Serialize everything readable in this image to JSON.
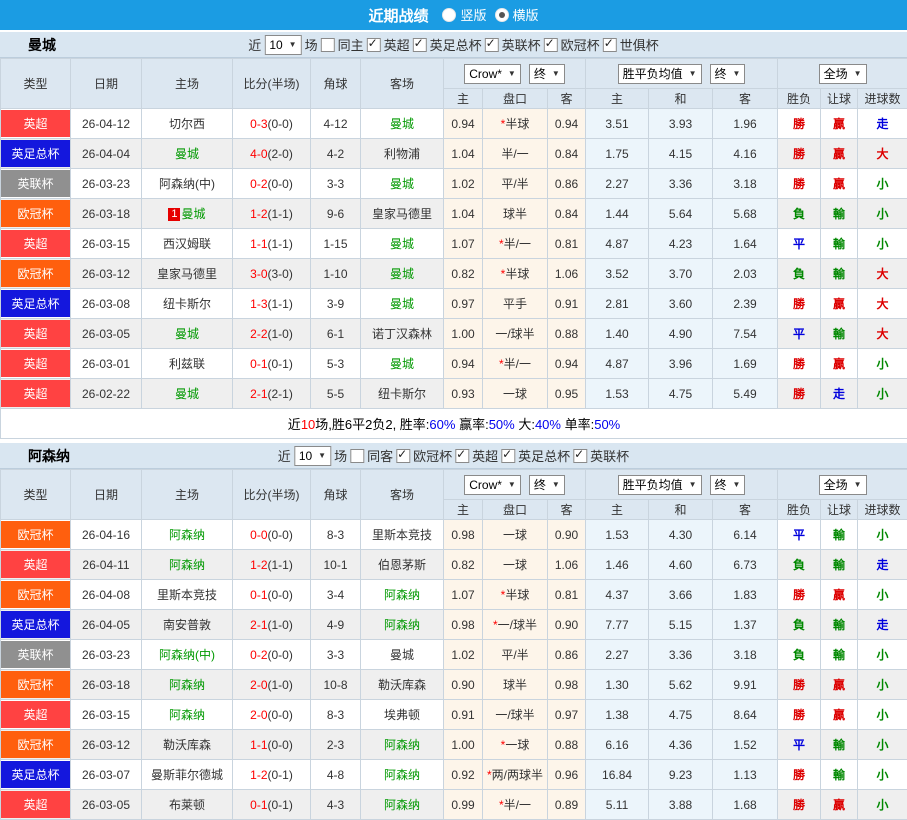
{
  "topbar": {
    "title": "近期战绩",
    "radios": [
      {
        "label": "竖版",
        "checked": false
      },
      {
        "label": "横版",
        "checked": true
      }
    ]
  },
  "table_head": {
    "type": "类型",
    "date": "日期",
    "home": "主场",
    "score": "比分(半场)",
    "corner": "角球",
    "away": "客场",
    "h": "主",
    "handicap": "盘口",
    "a": "客",
    "avg_h": "主",
    "avg_d": "和",
    "avg_a": "客",
    "result": "胜负",
    "let_ball": "让球",
    "goals": "进球数"
  },
  "selects": {
    "near_count": "10",
    "odds": "Crow*",
    "final": "终",
    "avg": "胜平负均值",
    "final2": "终",
    "scope": "全场"
  },
  "labels": {
    "near": "近",
    "matches": "场"
  },
  "league_colors": {
    "英超": "#ff4242",
    "英足总杯": "#1417dd",
    "英联杯": "#909090",
    "欧冠杯": "#ff5f0e"
  },
  "sections": [
    {
      "team": "曼城",
      "same_label": "同主",
      "same_checked": false,
      "filters": [
        "英超",
        "英足总杯",
        "英联杯",
        "欧冠杯",
        "世俱杯"
      ],
      "rows": [
        {
          "lg": "英超",
          "date": "26-04-12",
          "home": "切尔西",
          "hHL": false,
          "rank": "",
          "score": "0-3",
          "ht": "(0-0)",
          "cor": "4-12",
          "away": "曼城",
          "aHL": true,
          "o1": "0.94",
          "hc": "*半球",
          "o2": "0.94",
          "m1": "3.51",
          "m2": "3.93",
          "m3": "1.96",
          "res": [
            "勝",
            "r"
          ],
          "let": [
            "贏",
            "r"
          ],
          "goal": [
            "走",
            "b"
          ]
        },
        {
          "lg": "英足总杯",
          "date": "26-04-04",
          "home": "曼城",
          "hHL": true,
          "rank": "",
          "score": "4-0",
          "ht": "(2-0)",
          "cor": "4-2",
          "away": "利物浦",
          "aHL": false,
          "o1": "1.04",
          "hc": "半/一",
          "o2": "0.84",
          "m1": "1.75",
          "m2": "4.15",
          "m3": "4.16",
          "res": [
            "勝",
            "r"
          ],
          "let": [
            "贏",
            "r"
          ],
          "goal": [
            "大",
            "r"
          ]
        },
        {
          "lg": "英联杯",
          "date": "26-03-23",
          "home": "阿森纳(中)",
          "hHL": false,
          "rank": "",
          "score": "0-2",
          "ht": "(0-0)",
          "cor": "3-3",
          "away": "曼城",
          "aHL": true,
          "o1": "1.02",
          "hc": "平/半",
          "o2": "0.86",
          "m1": "2.27",
          "m2": "3.36",
          "m3": "3.18",
          "res": [
            "勝",
            "r"
          ],
          "let": [
            "贏",
            "r"
          ],
          "goal": [
            "小",
            "g"
          ]
        },
        {
          "lg": "欧冠杯",
          "date": "26-03-18",
          "home": "曼城",
          "hHL": true,
          "rank": "1",
          "score": "1-2",
          "ht": "(1-1)",
          "cor": "9-6",
          "away": "皇家马德里",
          "aHL": false,
          "o1": "1.04",
          "hc": "球半",
          "o2": "0.84",
          "m1": "1.44",
          "m2": "5.64",
          "m3": "5.68",
          "res": [
            "負",
            "g"
          ],
          "let": [
            "輸",
            "g"
          ],
          "goal": [
            "小",
            "g"
          ]
        },
        {
          "lg": "英超",
          "date": "26-03-15",
          "home": "西汉姆联",
          "hHL": false,
          "rank": "",
          "score": "1-1",
          "ht": "(1-1)",
          "cor": "1-15",
          "away": "曼城",
          "aHL": true,
          "o1": "1.07",
          "hc": "*半/一",
          "o2": "0.81",
          "m1": "4.87",
          "m2": "4.23",
          "m3": "1.64",
          "res": [
            "平",
            "b"
          ],
          "let": [
            "輸",
            "g"
          ],
          "goal": [
            "小",
            "g"
          ]
        },
        {
          "lg": "欧冠杯",
          "date": "26-03-12",
          "home": "皇家马德里",
          "hHL": false,
          "rank": "",
          "score": "3-0",
          "ht": "(3-0)",
          "cor": "1-10",
          "away": "曼城",
          "aHL": true,
          "o1": "0.82",
          "hc": "*半球",
          "o2": "1.06",
          "m1": "3.52",
          "m2": "3.70",
          "m3": "2.03",
          "res": [
            "負",
            "g"
          ],
          "let": [
            "輸",
            "g"
          ],
          "goal": [
            "大",
            "r"
          ]
        },
        {
          "lg": "英足总杯",
          "date": "26-03-08",
          "home": "纽卡斯尔",
          "hHL": false,
          "rank": "",
          "score": "1-3",
          "ht": "(1-1)",
          "cor": "3-9",
          "away": "曼城",
          "aHL": true,
          "o1": "0.97",
          "hc": "平手",
          "o2": "0.91",
          "m1": "2.81",
          "m2": "3.60",
          "m3": "2.39",
          "res": [
            "勝",
            "r"
          ],
          "let": [
            "贏",
            "r"
          ],
          "goal": [
            "大",
            "r"
          ]
        },
        {
          "lg": "英超",
          "date": "26-03-05",
          "home": "曼城",
          "hHL": true,
          "rank": "",
          "score": "2-2",
          "ht": "(1-0)",
          "cor": "6-1",
          "away": "诺丁汉森林",
          "aHL": false,
          "o1": "1.00",
          "hc": "一/球半",
          "o2": "0.88",
          "m1": "1.40",
          "m2": "4.90",
          "m3": "7.54",
          "res": [
            "平",
            "b"
          ],
          "let": [
            "輸",
            "g"
          ],
          "goal": [
            "大",
            "r"
          ]
        },
        {
          "lg": "英超",
          "date": "26-03-01",
          "home": "利兹联",
          "hHL": false,
          "rank": "",
          "score": "0-1",
          "ht": "(0-1)",
          "cor": "5-3",
          "away": "曼城",
          "aHL": true,
          "o1": "0.94",
          "hc": "*半/一",
          "o2": "0.94",
          "m1": "4.87",
          "m2": "3.96",
          "m3": "1.69",
          "res": [
            "勝",
            "r"
          ],
          "let": [
            "贏",
            "r"
          ],
          "goal": [
            "小",
            "g"
          ]
        },
        {
          "lg": "英超",
          "date": "26-02-22",
          "home": "曼城",
          "hHL": true,
          "rank": "",
          "score": "2-1",
          "ht": "(2-1)",
          "cor": "5-5",
          "away": "纽卡斯尔",
          "aHL": false,
          "o1": "0.93",
          "hc": "一球",
          "o2": "0.95",
          "m1": "1.53",
          "m2": "4.75",
          "m3": "5.49",
          "res": [
            "勝",
            "r"
          ],
          "let": [
            "走",
            "b"
          ],
          "goal": [
            "小",
            "g"
          ]
        }
      ],
      "summary_parts": [
        [
          "近",
          "k"
        ],
        [
          "10",
          "r"
        ],
        [
          "场,胜6平2负2, 胜率:",
          "k"
        ],
        [
          "60%",
          "b"
        ],
        [
          " 赢率:",
          "k"
        ],
        [
          "50%",
          "b"
        ],
        [
          " 大:",
          "k"
        ],
        [
          "40%",
          "b"
        ],
        [
          " 单率:",
          "k"
        ],
        [
          "50%",
          "b"
        ]
      ]
    },
    {
      "team": "阿森纳",
      "same_label": "同客",
      "same_checked": false,
      "filters": [
        "欧冠杯",
        "英超",
        "英足总杯",
        "英联杯"
      ],
      "rows": [
        {
          "lg": "欧冠杯",
          "date": "26-04-16",
          "home": "阿森纳",
          "hHL": true,
          "rank": "",
          "score": "0-0",
          "ht": "(0-0)",
          "cor": "8-3",
          "away": "里斯本竞技",
          "aHL": false,
          "o1": "0.98",
          "hc": "一球",
          "o2": "0.90",
          "m1": "1.53",
          "m2": "4.30",
          "m3": "6.14",
          "res": [
            "平",
            "b"
          ],
          "let": [
            "輸",
            "g"
          ],
          "goal": [
            "小",
            "g"
          ]
        },
        {
          "lg": "英超",
          "date": "26-04-11",
          "home": "阿森纳",
          "hHL": true,
          "rank": "",
          "score": "1-2",
          "ht": "(1-1)",
          "cor": "10-1",
          "away": "伯恩茅斯",
          "aHL": false,
          "o1": "0.82",
          "hc": "一球",
          "o2": "1.06",
          "m1": "1.46",
          "m2": "4.60",
          "m3": "6.73",
          "res": [
            "負",
            "g"
          ],
          "let": [
            "輸",
            "g"
          ],
          "goal": [
            "走",
            "b"
          ]
        },
        {
          "lg": "欧冠杯",
          "date": "26-04-08",
          "home": "里斯本竞技",
          "hHL": false,
          "rank": "",
          "score": "0-1",
          "ht": "(0-0)",
          "cor": "3-4",
          "away": "阿森纳",
          "aHL": true,
          "o1": "1.07",
          "hc": "*半球",
          "o2": "0.81",
          "m1": "4.37",
          "m2": "3.66",
          "m3": "1.83",
          "res": [
            "勝",
            "r"
          ],
          "let": [
            "贏",
            "r"
          ],
          "goal": [
            "小",
            "g"
          ]
        },
        {
          "lg": "英足总杯",
          "date": "26-04-05",
          "home": "南安普敦",
          "hHL": false,
          "rank": "",
          "score": "2-1",
          "ht": "(1-0)",
          "cor": "4-9",
          "away": "阿森纳",
          "aHL": true,
          "o1": "0.98",
          "hc": "*一/球半",
          "o2": "0.90",
          "m1": "7.77",
          "m2": "5.15",
          "m3": "1.37",
          "res": [
            "負",
            "g"
          ],
          "let": [
            "輸",
            "g"
          ],
          "goal": [
            "走",
            "b"
          ]
        },
        {
          "lg": "英联杯",
          "date": "26-03-23",
          "home": "阿森纳(中)",
          "hHL": true,
          "rank": "",
          "score": "0-2",
          "ht": "(0-0)",
          "cor": "3-3",
          "away": "曼城",
          "aHL": false,
          "o1": "1.02",
          "hc": "平/半",
          "o2": "0.86",
          "m1": "2.27",
          "m2": "3.36",
          "m3": "3.18",
          "res": [
            "負",
            "g"
          ],
          "let": [
            "輸",
            "g"
          ],
          "goal": [
            "小",
            "g"
          ]
        },
        {
          "lg": "欧冠杯",
          "date": "26-03-18",
          "home": "阿森纳",
          "hHL": true,
          "rank": "",
          "score": "2-0",
          "ht": "(1-0)",
          "cor": "10-8",
          "away": "勒沃库森",
          "aHL": false,
          "o1": "0.90",
          "hc": "球半",
          "o2": "0.98",
          "m1": "1.30",
          "m2": "5.62",
          "m3": "9.91",
          "res": [
            "勝",
            "r"
          ],
          "let": [
            "贏",
            "r"
          ],
          "goal": [
            "小",
            "g"
          ]
        },
        {
          "lg": "英超",
          "date": "26-03-15",
          "home": "阿森纳",
          "hHL": true,
          "rank": "",
          "score": "2-0",
          "ht": "(0-0)",
          "cor": "8-3",
          "away": "埃弗顿",
          "aHL": false,
          "o1": "0.91",
          "hc": "一/球半",
          "o2": "0.97",
          "m1": "1.38",
          "m2": "4.75",
          "m3": "8.64",
          "res": [
            "勝",
            "r"
          ],
          "let": [
            "贏",
            "r"
          ],
          "goal": [
            "小",
            "g"
          ]
        },
        {
          "lg": "欧冠杯",
          "date": "26-03-12",
          "home": "勒沃库森",
          "hHL": false,
          "rank": "",
          "score": "1-1",
          "ht": "(0-0)",
          "cor": "2-3",
          "away": "阿森纳",
          "aHL": true,
          "o1": "1.00",
          "hc": "*一球",
          "o2": "0.88",
          "m1": "6.16",
          "m2": "4.36",
          "m3": "1.52",
          "res": [
            "平",
            "b"
          ],
          "let": [
            "輸",
            "g"
          ],
          "goal": [
            "小",
            "g"
          ]
        },
        {
          "lg": "英足总杯",
          "date": "26-03-07",
          "home": "曼斯菲尔德城",
          "hHL": false,
          "rank": "",
          "score": "1-2",
          "ht": "(0-1)",
          "cor": "4-8",
          "away": "阿森纳",
          "aHL": true,
          "o1": "0.92",
          "hc": "*两/两球半",
          "o2": "0.96",
          "m1": "16.84",
          "m2": "9.23",
          "m3": "1.13",
          "res": [
            "勝",
            "r"
          ],
          "let": [
            "輸",
            "g"
          ],
          "goal": [
            "小",
            "g"
          ]
        },
        {
          "lg": "英超",
          "date": "26-03-05",
          "home": "布莱顿",
          "hHL": false,
          "rank": "",
          "score": "0-1",
          "ht": "(0-1)",
          "cor": "4-3",
          "away": "阿森纳",
          "aHL": true,
          "o1": "0.99",
          "hc": "*半/一",
          "o2": "0.89",
          "m1": "5.11",
          "m2": "3.88",
          "m3": "1.68",
          "res": [
            "勝",
            "r"
          ],
          "let": [
            "贏",
            "r"
          ],
          "goal": [
            "小",
            "g"
          ]
        }
      ],
      "summary_parts": null
    }
  ]
}
